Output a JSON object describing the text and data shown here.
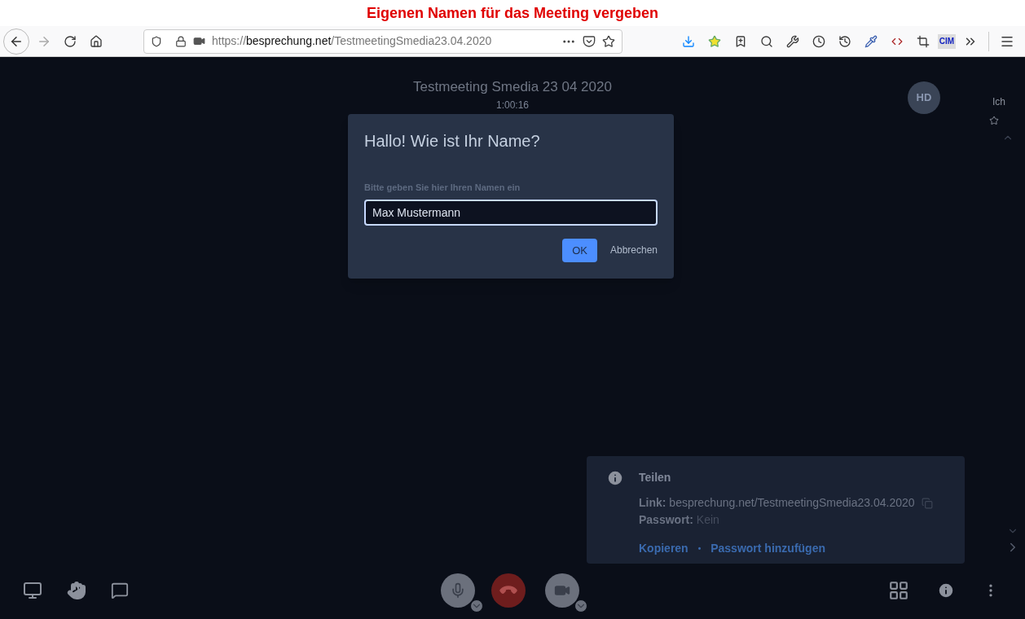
{
  "caption": "Eigenen Namen für das Meeting vergeben",
  "browser": {
    "url": {
      "scheme": "https://",
      "host": "besprechung.net",
      "path": "/TestmeetingSmedia23.04.2020"
    },
    "extension_label": "CIM"
  },
  "meeting": {
    "title": "Testmeeting Smedia 23 04 2020",
    "timer": "1:00:16"
  },
  "participant": {
    "initials": "HD",
    "name": "Ich"
  },
  "dialog": {
    "title": "Hallo! Wie ist Ihr Name?",
    "label": "Bitte geben Sie hier Ihren Namen ein",
    "value": "Max Mustermann",
    "ok": "OK",
    "cancel": "Abbrechen"
  },
  "share": {
    "title": "Teilen",
    "link_label": "Link:",
    "link": "besprechung.net/TestmeetingSmedia23.04.2020",
    "password_label": "Passwort:",
    "password": "Kein",
    "copy": "Kopieren",
    "separator": "•",
    "add_password": "Passwort hinzufügen"
  }
}
